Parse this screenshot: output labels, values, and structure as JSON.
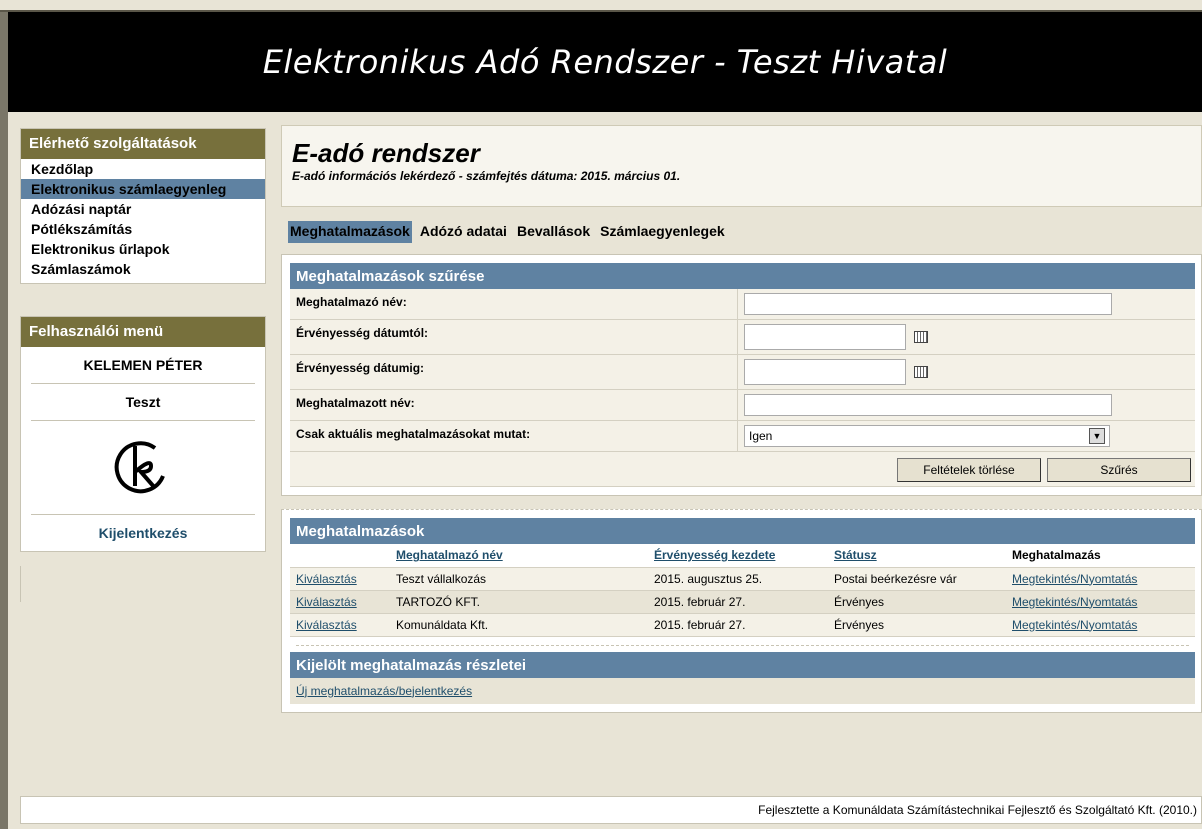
{
  "app_title": "Elektronikus Adó Rendszer - Teszt Hivatal",
  "sidebar": {
    "services_title": "Elérhető szolgáltatások",
    "items": [
      {
        "label": "Kezdőlap"
      },
      {
        "label": "Elektronikus számlaegyenleg",
        "active": true
      },
      {
        "label": "Adózási naptár"
      },
      {
        "label": "Pótlékszámítás"
      },
      {
        "label": "Elektronikus űrlapok"
      },
      {
        "label": "Számlaszámok"
      }
    ],
    "user_menu_title": "Felhasználói menü",
    "user_name": "KELEMEN PÉTER",
    "organization": "Teszt",
    "logout_label": "Kijelentkezés"
  },
  "main": {
    "title": "E-adó rendszer",
    "subtitle": "E-adó információs lekérdező - számfejtés dátuma: 2015. március 01.",
    "tabs": [
      {
        "label": "Meghatalmazások",
        "active": true
      },
      {
        "label": "Adózó adatai"
      },
      {
        "label": "Bevallások"
      },
      {
        "label": "Számlaegyenlegek"
      }
    ]
  },
  "filter": {
    "title": "Meghatalmazások szűrése",
    "fields": {
      "grantor_name": {
        "label": "Meghatalmazó név:",
        "value": ""
      },
      "valid_from": {
        "label": "Érvényesség dátumtól:",
        "value": ""
      },
      "valid_to": {
        "label": "Érvényesség dátumig:",
        "value": ""
      },
      "grantee_name": {
        "label": "Meghatalmazott név:",
        "value": ""
      },
      "current_only": {
        "label": "Csak aktuális meghatalmazásokat mutat:",
        "value": "Igen"
      }
    },
    "clear_label": "Feltételek törlése",
    "filter_label": "Szűrés"
  },
  "authorizations": {
    "title": "Meghatalmazások",
    "headers": [
      "",
      "Meghatalmazó név",
      "Érvényesség kezdete",
      "Státusz",
      "Meghatalmazás"
    ],
    "rows": [
      {
        "select": "Kiválasztás",
        "name": "Teszt vállalkozás",
        "start": "2015. augusztus 25.",
        "status": "Postai beérkezésre vár",
        "action": "Megtekintés/Nyomtatás"
      },
      {
        "select": "Kiválasztás",
        "name": "TARTOZÓ KFT.",
        "start": "2015. február 27.",
        "status": "Érvényes",
        "action": "Megtekintés/Nyomtatás"
      },
      {
        "select": "Kiválasztás",
        "name": "Komunáldata Kft.",
        "start": "2015. február 27.",
        "status": "Érvényes",
        "action": "Megtekintés/Nyomtatás"
      }
    ]
  },
  "details": {
    "title": "Kijelölt meghatalmazás részletei",
    "new_link": "Új meghatalmazás/bejelentkezés"
  },
  "footer": "Fejlesztette a Komunáldata Számítástechnikai Fejlesztő és Szolgáltató Kft. (2010.)",
  "colors": {
    "header_bg": "#000000",
    "sidebar_head": "#77703c",
    "accent": "#5f82a2",
    "page_bg": "#e8e4d6"
  }
}
